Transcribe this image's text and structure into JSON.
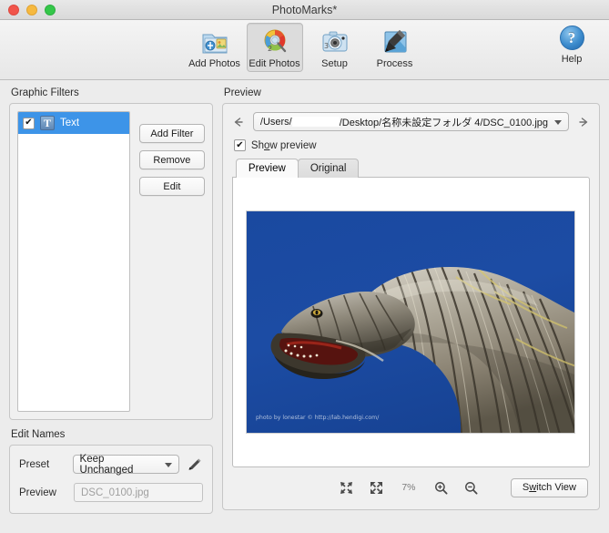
{
  "window": {
    "title": "PhotoMarks*",
    "traffic_lights": [
      "close",
      "minimize",
      "zoom"
    ]
  },
  "toolbar": {
    "items": [
      {
        "label": "Add Photos",
        "icon": "add-photos-icon",
        "selected": false
      },
      {
        "label": "Edit Photos",
        "icon": "edit-photos-icon",
        "selected": true
      },
      {
        "label": "Setup",
        "icon": "setup-icon",
        "selected": false
      },
      {
        "label": "Process",
        "icon": "process-icon",
        "selected": false
      }
    ],
    "help": {
      "label": "Help",
      "icon": "help-icon",
      "glyph": "?"
    }
  },
  "graphic_filters": {
    "title": "Graphic Filters",
    "rows": [
      {
        "checked": true,
        "check_glyph": "✔",
        "icon_glyph": "T",
        "icon": "text-filter-icon",
        "label": "Text",
        "selected": true
      }
    ],
    "buttons": [
      {
        "label": "Add Filter"
      },
      {
        "label": "Remove"
      },
      {
        "label": "Edit"
      }
    ]
  },
  "edit_names": {
    "title": "Edit Names",
    "preset_label": "Preset",
    "preset_value": "Keep Unchanged",
    "edit_icon": "pencil-icon",
    "preview_label": "Preview",
    "preview_value": "DSC_0100.jpg"
  },
  "preview": {
    "title": "Preview",
    "back_icon": "arrow-left-icon",
    "forward_icon": "arrow-right-icon",
    "path_prefix": "/Users/",
    "path_suffix": "/Desktop/名称未設定フォルダ 4/DSC_0100.jpg",
    "show_preview": {
      "checked": true,
      "check_glyph": "✔",
      "label_pre": "Sh",
      "label_key": "o",
      "label_post": "w preview"
    },
    "tabs": [
      {
        "label": "Preview",
        "active": true
      },
      {
        "label": "Original",
        "active": false
      }
    ],
    "image": {
      "alt": "dinosaur sculpture neck against blue sky",
      "sky_color": "#1a4a9e",
      "watermark": "photo by lonestar © http://lab.hendigi.com/"
    },
    "bottom_bar": {
      "fit_icon": "collapse-arrows-icon",
      "expand_icon": "expand-arrows-icon",
      "zoom_level": "7%",
      "zoom_in_icon": "zoom-in-icon",
      "zoom_out_icon": "zoom-out-icon",
      "switch_view": {
        "pre": "S",
        "key": "w",
        "post": "itch View"
      }
    }
  }
}
